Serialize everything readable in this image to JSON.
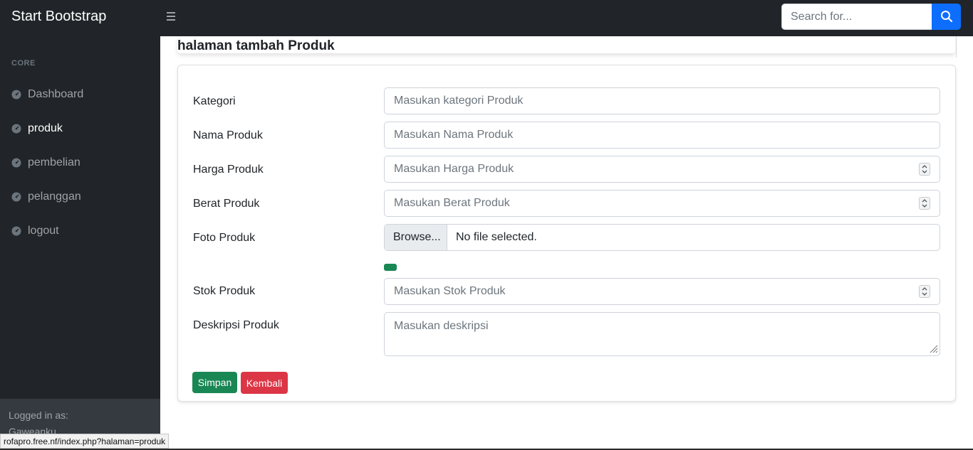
{
  "navbar": {
    "brand": "Start Bootstrap",
    "toggle_icon": "bars-icon",
    "search_placeholder": "Search for...",
    "search_icon": "search-icon",
    "search_button_color": "#0d6efd"
  },
  "sidebar": {
    "heading": "CORE",
    "items": [
      {
        "label": "Dashboard",
        "icon": "tachometer-icon",
        "active": false
      },
      {
        "label": "produk",
        "icon": "tachometer-icon",
        "active": true
      },
      {
        "label": "pembelian",
        "icon": "tachometer-icon",
        "active": false
      },
      {
        "label": "pelanggan",
        "icon": "tachometer-icon",
        "active": false
      },
      {
        "label": "logout",
        "icon": "tachometer-icon",
        "active": false
      }
    ],
    "footer": {
      "logged_label": "Logged in as:",
      "username": "Gaweanku"
    }
  },
  "page": {
    "title": "halaman tambah Produk"
  },
  "form": {
    "kategori": {
      "label": "Kategori",
      "placeholder": "Masukan kategori Produk"
    },
    "nama": {
      "label": "Nama Produk",
      "placeholder": "Masukan Nama Produk"
    },
    "harga": {
      "label": "Harga Produk",
      "placeholder": "Masukan Harga Produk"
    },
    "berat": {
      "label": "Berat Produk",
      "placeholder": "Masukan Berat Produk"
    },
    "foto": {
      "label": "Foto Produk",
      "button": "Browse...",
      "file_name": "No file selected."
    },
    "stok": {
      "label": "Stok Produk",
      "placeholder": "Masukan Stok Produk"
    },
    "deskripsi": {
      "label": "Deskripsi Produk",
      "placeholder": "Masukan deskripsi"
    },
    "save_button": "Simpan",
    "back_button": "Kembali"
  },
  "colors": {
    "save": "#198754",
    "back": "#dc3545",
    "dark": "#212529"
  },
  "statusbar": {
    "url": "rofapro.free.nf/index.php?halaman=produk"
  }
}
